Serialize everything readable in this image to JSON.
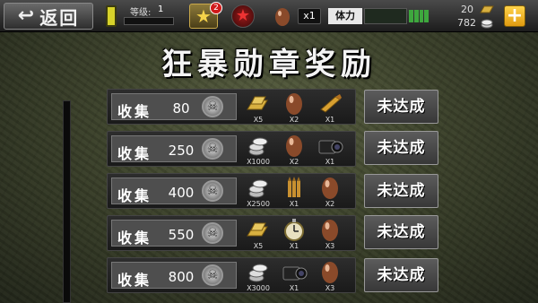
{
  "topbar": {
    "back_label": "返回",
    "level_label": "等级:",
    "level_value": "1",
    "xp_progress": 0.0,
    "star_badge": "2",
    "egg_count": "x1",
    "stamina_label": "体力",
    "resource_1": "20",
    "resource_2": "782"
  },
  "title": "狂暴勋章奖励",
  "rows": [
    {
      "label": "收集",
      "number": "80",
      "rewards": [
        {
          "icon": "gold-bars-icon",
          "qty": "X5"
        },
        {
          "icon": "egg-icon",
          "qty": "X2"
        },
        {
          "icon": "bullet-icon",
          "qty": "X1"
        }
      ],
      "status": "未达成"
    },
    {
      "label": "收集",
      "number": "250",
      "rewards": [
        {
          "icon": "silver-coins-icon",
          "qty": "X1000"
        },
        {
          "icon": "egg-icon",
          "qty": "X2"
        },
        {
          "icon": "camera-icon",
          "qty": "X1"
        }
      ],
      "status": "未达成"
    },
    {
      "label": "收集",
      "number": "400",
      "rewards": [
        {
          "icon": "silver-coins-icon",
          "qty": "X2500"
        },
        {
          "icon": "bullets-icon",
          "qty": "X1"
        },
        {
          "icon": "egg-icon",
          "qty": "X2"
        }
      ],
      "status": "未达成"
    },
    {
      "label": "收集",
      "number": "550",
      "rewards": [
        {
          "icon": "gold-bars-icon",
          "qty": "X5"
        },
        {
          "icon": "stopwatch-icon",
          "qty": "X1"
        },
        {
          "icon": "egg-icon",
          "qty": "X3"
        }
      ],
      "status": "未达成"
    },
    {
      "label": "收集",
      "number": "800",
      "rewards": [
        {
          "icon": "silver-coins-icon",
          "qty": "X3000"
        },
        {
          "icon": "camera-icon",
          "qty": "X1"
        },
        {
          "icon": "egg-icon",
          "qty": "X3"
        }
      ],
      "status": "未达成"
    }
  ],
  "colors": {
    "accent_gold": "#ffd34a",
    "badge_red": "#d01a1a",
    "stamina_green": "#3ea83e"
  }
}
